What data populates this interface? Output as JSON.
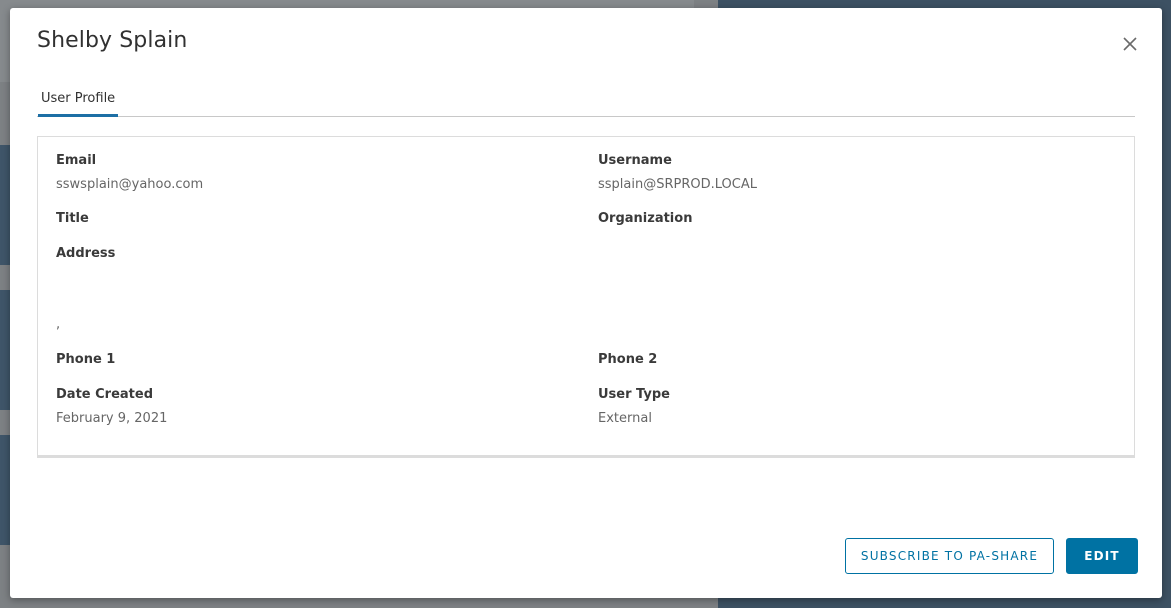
{
  "modal": {
    "title": "Shelby Splain",
    "close_icon": "close-icon"
  },
  "tabs": [
    {
      "label": "User Profile",
      "active": true
    }
  ],
  "profile": {
    "email_label": "Email",
    "email_value": "sswsplain@yahoo.com",
    "username_label": "Username",
    "username_value": "ssplain@SRPROD.LOCAL",
    "title_label": "Title",
    "organization_label": "Organization",
    "address_label": "Address",
    "address_value": ",",
    "phone1_label": "Phone 1",
    "phone2_label": "Phone 2",
    "date_created_label": "Date Created",
    "date_created_value": "February 9, 2021",
    "user_type_label": "User Type",
    "user_type_value": "External"
  },
  "actions": {
    "subscribe_label": "SUBSCRIBE TO PA-SHARE",
    "edit_label": "EDIT"
  },
  "colors": {
    "accent": "#0072a3",
    "tab_underline": "#1d6fa5"
  }
}
